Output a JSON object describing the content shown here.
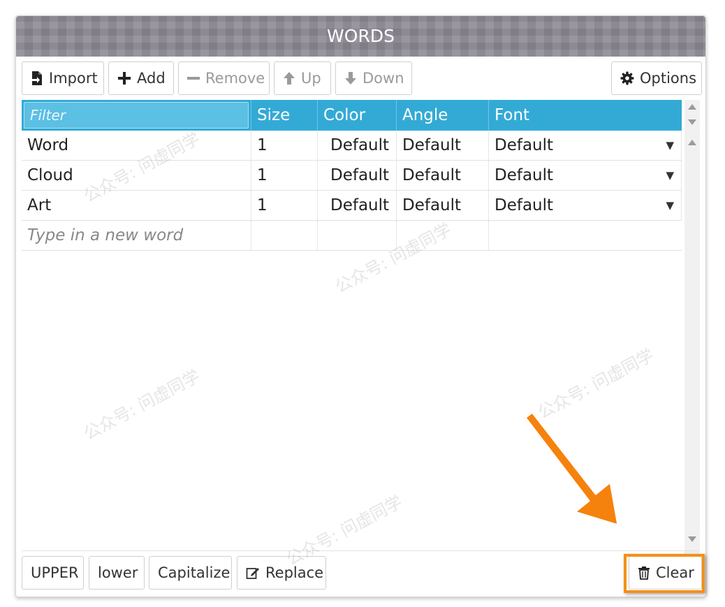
{
  "header": {
    "title": "WORDS"
  },
  "toolbar": {
    "import_label": "Import",
    "add_label": "Add",
    "remove_label": "Remove",
    "up_label": "Up",
    "down_label": "Down",
    "options_label": "Options"
  },
  "grid": {
    "filter_placeholder": "Filter",
    "columns": [
      "Size",
      "Color",
      "Angle",
      "Font"
    ],
    "rows": [
      {
        "word": "Word",
        "size": "1",
        "color": "Default",
        "angle": "Default",
        "font": "Default"
      },
      {
        "word": "Cloud",
        "size": "1",
        "color": "Default",
        "angle": "Default",
        "font": "Default"
      },
      {
        "word": "Art",
        "size": "1",
        "color": "Default",
        "angle": "Default",
        "font": "Default"
      }
    ],
    "new_word_placeholder": "Type in a new word"
  },
  "bottom": {
    "upper_label": "UPPER",
    "lower_label": "lower",
    "capitalize_label": "Capitalize",
    "replace_label": "Replace",
    "clear_label": "Clear"
  },
  "annotation": {
    "highlight_color": "#f39016",
    "arrow_color": "#f5820d"
  },
  "watermark": {
    "text": "公众号: 问虚同学"
  },
  "colors": {
    "header_bg": "#8d8a95",
    "grid_header_bg": "#33aad6"
  }
}
